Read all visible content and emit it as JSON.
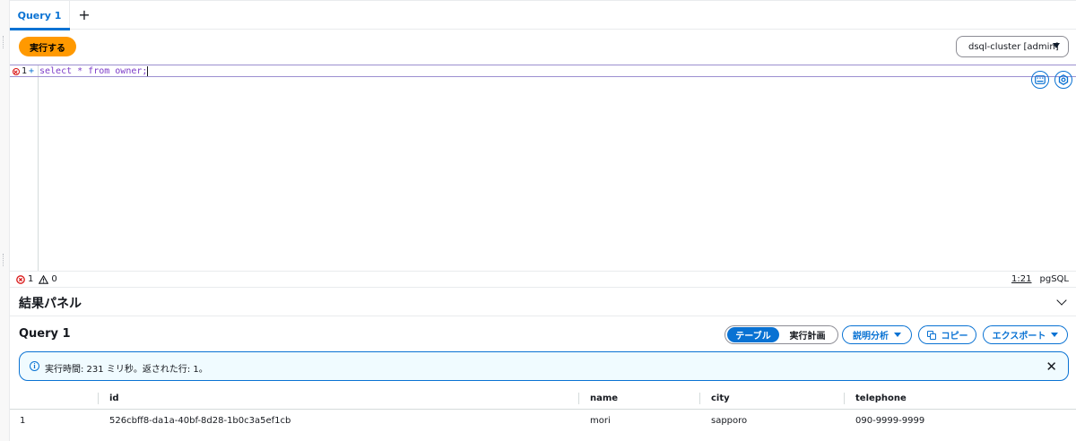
{
  "tabs": [
    {
      "label": "Query 1",
      "active": true
    }
  ],
  "tab_add_symbol": "+",
  "toolbar": {
    "run_label": "実行する",
    "cluster_value": "dsql-cluster [admin]"
  },
  "editor": {
    "line_number": "1",
    "fold_marker": "+",
    "code": "select * from owner;",
    "icons": [
      "keyboard-icon",
      "settings-icon"
    ]
  },
  "status": {
    "errors": "1",
    "warnings": "0",
    "position": "1:21",
    "language": "pgSQL"
  },
  "results_panel": {
    "title": "結果パネル"
  },
  "query_result": {
    "title": "Query 1",
    "view_toggle": {
      "table_label": "テーブル",
      "plan_label": "実行計画",
      "selected": "テーブル"
    },
    "explain_label": "説明分析",
    "copy_label": "コピー",
    "export_label": "エクスポート",
    "banner_message": "実行時間: 231 ミリ秒。返された行: 1。",
    "columns": [
      "",
      "id",
      "name",
      "city",
      "telephone"
    ],
    "rows": [
      [
        "1",
        "526cbff8-da1a-40bf-8d28-1b0c3a5ef1cb",
        "mori",
        "sapporo",
        "090-9999-9999"
      ]
    ]
  },
  "colors": {
    "accent": "#0972d3",
    "run_button": "#ff9900",
    "error": "#d91515",
    "banner_bg": "#f0fbff"
  }
}
